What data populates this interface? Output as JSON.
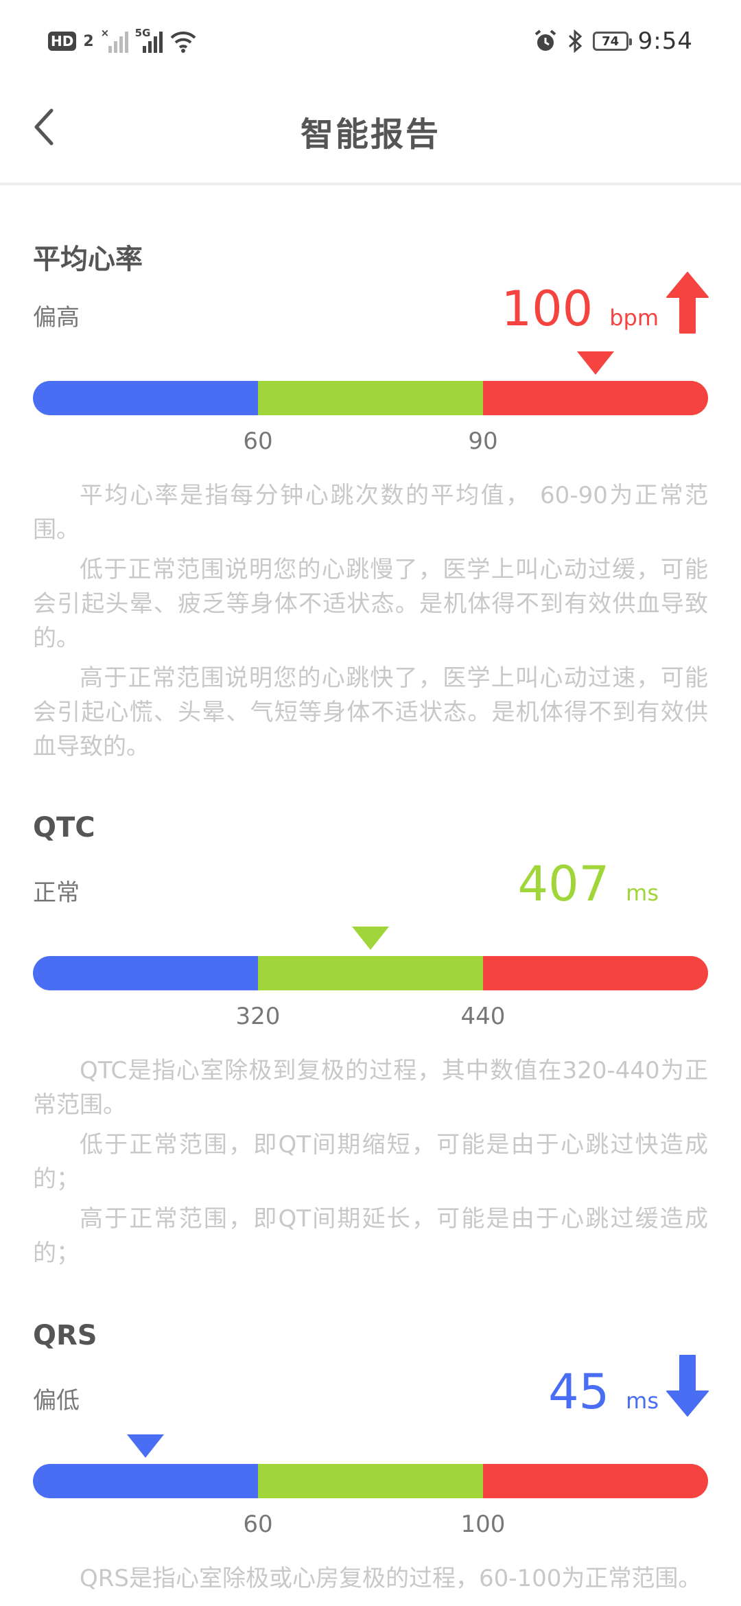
{
  "status_bar": {
    "hd_label": "HD",
    "hd_num": "2",
    "sig1_tag": "×",
    "sig2_tag": "5G",
    "battery": "74",
    "time": "9:54"
  },
  "nav": {
    "title": "智能报告"
  },
  "colors": {
    "low": "#4a6ef3",
    "normal": "#a1d63a",
    "high": "#f5433f"
  },
  "sections": [
    {
      "title": "平均心率",
      "status": "偏高",
      "value": "100",
      "unit": "bpm",
      "trend": "up",
      "marker_level": 0.833,
      "ticks": [
        "60",
        "90"
      ],
      "desc": [
        "平均心率是指每分钟心跳次数的平均值， 60-90为正常范围。",
        "低于正常范围说明您的心跳慢了，医学上叫心动过缓，可能会引起头晕、疲乏等身体不适状态。是机体得不到有效供血导致的。",
        "高于正常范围说明您的心跳快了，医学上叫心动过速，可能会引起心慌、头晕、气短等身体不适状态。是机体得不到有效供血导致的。"
      ]
    },
    {
      "title": "QTC",
      "status": "正常",
      "value": "407",
      "unit": "ms",
      "trend": "none",
      "marker_level": 0.5,
      "ticks": [
        "320",
        "440"
      ],
      "desc": [
        "QTC是指心室除极到复极的过程，其中数值在320-440为正常范围。",
        "低于正常范围，即QT间期缩短，可能是由于心跳过快造成的；",
        "高于正常范围，即QT间期延长，可能是由于心跳过缓造成的；"
      ]
    },
    {
      "title": "QRS",
      "status": "偏低",
      "value": "45",
      "unit": "ms",
      "trend": "down",
      "marker_level": 0.167,
      "ticks": [
        "60",
        "100"
      ],
      "desc": [
        "QRS是指心室除极或心房复极的过程，60-100为正常范围。"
      ]
    }
  ]
}
